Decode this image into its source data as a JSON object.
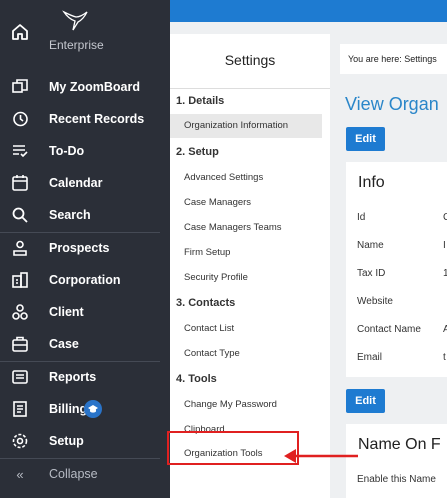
{
  "sidebar": {
    "brand": "Enterprise",
    "items": [
      {
        "label": "My ZoomBoard",
        "icon": "zoomboard-icon"
      },
      {
        "label": "Recent Records",
        "icon": "history-icon"
      },
      {
        "label": "To-Do",
        "icon": "todo-icon"
      },
      {
        "label": "Calendar",
        "icon": "calendar-icon"
      },
      {
        "label": "Search",
        "icon": "search-icon"
      },
      {
        "label": "Prospects",
        "icon": "prospects-icon"
      },
      {
        "label": "Corporation",
        "icon": "corporation-icon"
      },
      {
        "label": "Client",
        "icon": "client-icon"
      },
      {
        "label": "Case",
        "icon": "case-icon"
      },
      {
        "label": "Reports",
        "icon": "reports-icon"
      },
      {
        "label": "Billing",
        "icon": "billing-icon"
      },
      {
        "label": "Setup",
        "icon": "gear-icon"
      }
    ],
    "collapse": "Collapse"
  },
  "settings": {
    "title": "Settings",
    "sections": [
      {
        "title": "1. Details",
        "links": [
          "Organization Information"
        ]
      },
      {
        "title": "2. Setup",
        "links": [
          "Advanced Settings",
          "Case Managers",
          "Case Managers Teams",
          "Firm Setup",
          "Security Profile"
        ]
      },
      {
        "title": "3. Contacts",
        "links": [
          "Contact List",
          "Contact Type"
        ]
      },
      {
        "title": "4. Tools",
        "links": [
          "Change My Password",
          "Clipboard",
          "Organization Tools"
        ]
      }
    ]
  },
  "main": {
    "breadcrumb": "You are here: Settings",
    "title": "View Organ",
    "edit": "Edit",
    "info": {
      "title": "Info",
      "rows": [
        {
          "label": "Id",
          "value": "C"
        },
        {
          "label": "Name",
          "value": "I"
        },
        {
          "label": "Tax ID",
          "value": "1"
        },
        {
          "label": "Website",
          "value": ""
        },
        {
          "label": "Contact Name",
          "value": "A"
        },
        {
          "label": "Email",
          "value": "t"
        }
      ]
    },
    "name_card": {
      "title": "Name On F",
      "row": "Enable this Name"
    }
  },
  "colors": {
    "sidebar": "#2b2f38",
    "accent": "#1e7bd1",
    "highlight": "#e02020"
  }
}
